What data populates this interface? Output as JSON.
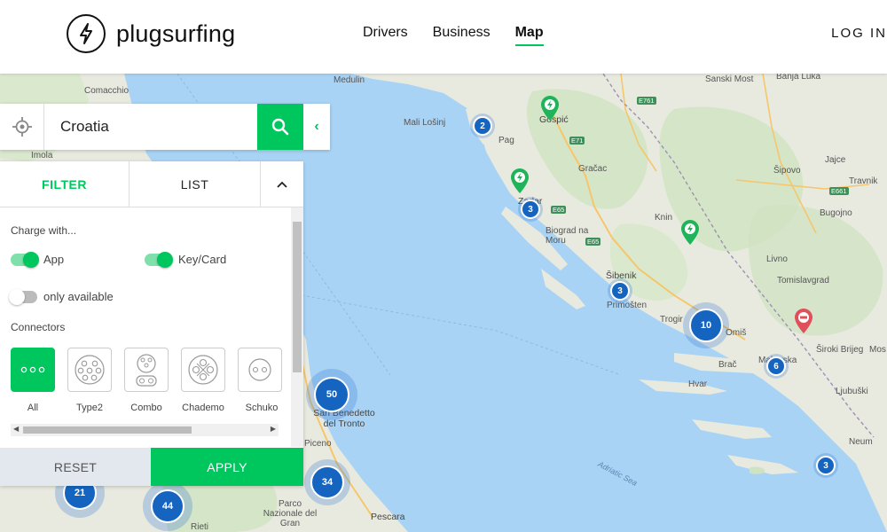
{
  "header": {
    "logo_text": "plugsurfing",
    "nav": [
      "Drivers",
      "Business",
      "Map"
    ],
    "active_nav": "Map",
    "login": "LOG IN",
    "accent": "#00c65e"
  },
  "search": {
    "value": "Croatia",
    "locate_icon": "crosshair-icon",
    "search_icon": "search-icon",
    "collapse_icon": "chevron-left-icon"
  },
  "panel": {
    "tabs": [
      "FILTER",
      "LIST"
    ],
    "active_tab": "FILTER",
    "toggle_icon": "chevron-up-icon",
    "charge_with_label": "Charge with...",
    "switches": [
      {
        "label": "App",
        "on": true
      },
      {
        "label": "Key/Card",
        "on": true
      },
      {
        "label": "only available",
        "on": false
      }
    ],
    "connectors_label": "Connectors",
    "connectors": [
      {
        "label": "All",
        "selected": true
      },
      {
        "label": "Type2",
        "selected": false
      },
      {
        "label": "Combo",
        "selected": false
      },
      {
        "label": "Chademo",
        "selected": false
      },
      {
        "label": "Schuko",
        "selected": false
      }
    ],
    "reset": "RESET",
    "apply": "APPLY"
  },
  "map": {
    "places": [
      "Comacchio",
      "Medulin",
      "Banja Luka",
      "Sanski Most",
      "Mali Lošinj",
      "Pag",
      "Gospić",
      "Gračac",
      "Zadar",
      "Biograd na Moru",
      "Knin",
      "Šipovo",
      "Jajce",
      "Travnik",
      "Bugojno",
      "Šibenik",
      "Primošten",
      "Livno",
      "Tomislavgrad",
      "Trogir",
      "Omiš",
      "Brač",
      "Makarska",
      "Široki Brijeg",
      "Hvar",
      "Ljubuški",
      "Imola",
      "San Benedetto del Tronto",
      "Piceno",
      "Neum",
      "Parco Nazionale del Gran",
      "Pescara",
      "Rieti",
      "Mos"
    ],
    "roads": [
      "E761",
      "E71",
      "E65",
      "E65",
      "E661"
    ],
    "sea_label": "Adriatic Sea",
    "clusters": [
      "2",
      "3",
      "3",
      "10",
      "6",
      "50",
      "34",
      "21",
      "44",
      "3"
    ],
    "pin_colors": {
      "station": "#1fb45a",
      "unavailable": "#e0505a"
    }
  }
}
